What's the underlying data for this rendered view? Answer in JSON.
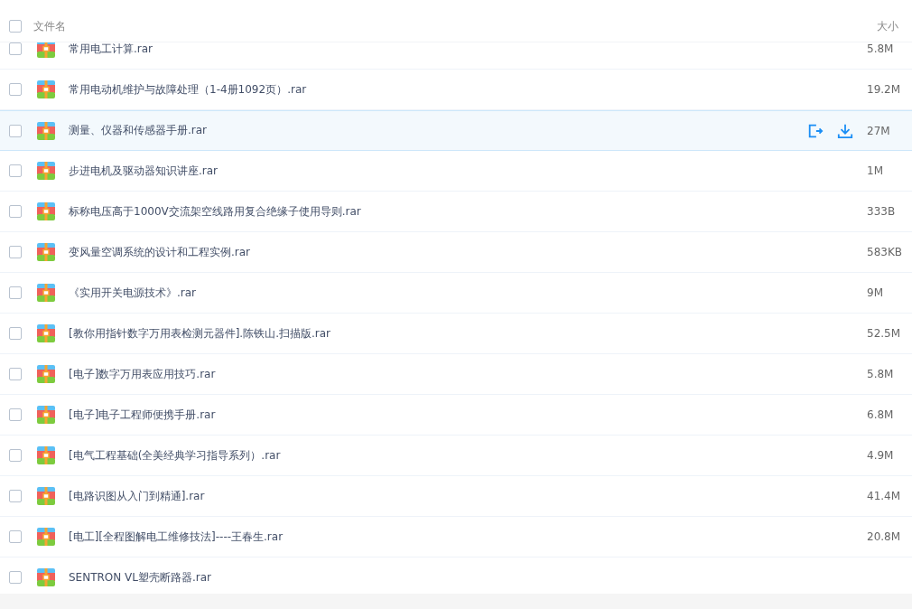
{
  "header": {
    "select_all_checked": false,
    "name_column": "文件名",
    "size_column": "大小"
  },
  "files": [
    {
      "name": "常用电工计算.rar",
      "size": "5.8M",
      "checked": false,
      "hovered": false
    },
    {
      "name": "常用电动机维护与故障处理（1-4册1092页）.rar",
      "size": "19.2M",
      "checked": false,
      "hovered": false
    },
    {
      "name": "测量、仪器和传感器手册.rar",
      "size": "27M",
      "checked": false,
      "hovered": true
    },
    {
      "name": "步进电机及驱动器知识讲座.rar",
      "size": "1M",
      "checked": false,
      "hovered": false
    },
    {
      "name": "标称电压高于1000V交流架空线路用复合绝缘子使用导则.rar",
      "size": "333B",
      "checked": false,
      "hovered": false
    },
    {
      "name": "变风量空调系统的设计和工程实例.rar",
      "size": "583KB",
      "checked": false,
      "hovered": false
    },
    {
      "name": "《实用开关电源技术》.rar",
      "size": "9M",
      "checked": false,
      "hovered": false
    },
    {
      "name": "[教你用指针数字万用表检测元器件].陈铁山.扫描版.rar",
      "size": "52.5M",
      "checked": false,
      "hovered": false
    },
    {
      "name": "[电子]数字万用表应用技巧.rar",
      "size": "5.8M",
      "checked": false,
      "hovered": false
    },
    {
      "name": "[电子]电子工程师便携手册.rar",
      "size": "6.8M",
      "checked": false,
      "hovered": false
    },
    {
      "name": "[电气工程基础(全美经典学习指导系列）.rar",
      "size": "4.9M",
      "checked": false,
      "hovered": false
    },
    {
      "name": "[电路识图从入门到精通].rar",
      "size": "41.4M",
      "checked": false,
      "hovered": false
    },
    {
      "name": "[电工][全程图解电工维修技法]----王春生.rar",
      "size": "20.8M",
      "checked": false,
      "hovered": false
    },
    {
      "name": "SENTRON VL塑壳断路器.rar",
      "checked": false,
      "hovered": false
    }
  ]
}
